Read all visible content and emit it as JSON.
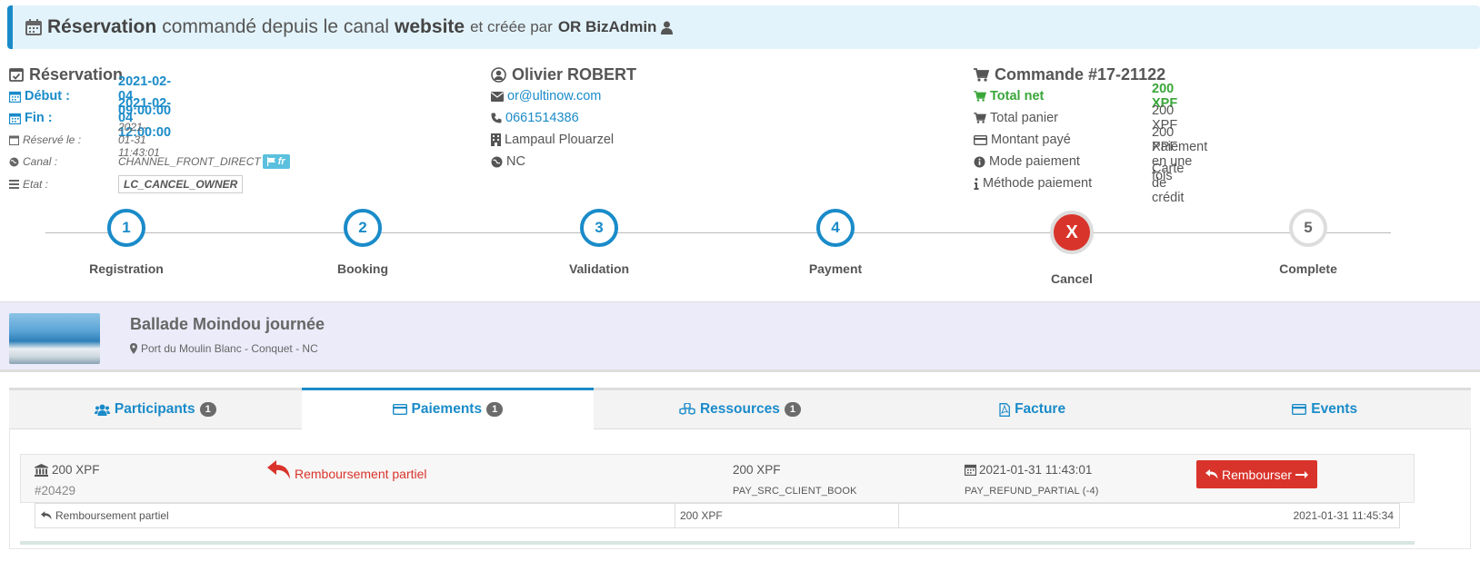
{
  "header": {
    "word1": "Réservation",
    "word2": "commandé depuis le canal",
    "channel": "website",
    "word3": "et créée par",
    "creator": "OR BizAdmin"
  },
  "reservation": {
    "title": "Réservation",
    "start_label": "Début :",
    "start_value": "2021-02-04 09:00:00",
    "end_label": "Fin :",
    "end_value": "2021-02-04 12:00:00",
    "booked_label": "Réservé le :",
    "booked_value": "2021-01-31 11:43:01",
    "channel_label": "Canal :",
    "channel_value": "CHANNEL_FRONT_DIRECT",
    "lang_badge": "fr",
    "state_label": "Etat :",
    "state_value": "LC_CANCEL_OWNER"
  },
  "customer": {
    "name": "Olivier ROBERT",
    "email": "or@ultinow.com",
    "phone": "0661514386",
    "city": "Lampaul Plouarzel",
    "country": "NC"
  },
  "order": {
    "title": "Commande #17-21122",
    "net_label": "Total net",
    "net_value": "200 XPF",
    "cart_label": "Total panier",
    "cart_value": "200 XPF",
    "paid_label": "Montant payé",
    "paid_value": "200 XPF",
    "mode_label": "Mode paiement",
    "mode_value": "Paiement en une fois",
    "method_label": "Méthode paiement",
    "method_value": "Carte de crédit"
  },
  "steps": [
    {
      "num": "1",
      "label": "Registration",
      "state": "done"
    },
    {
      "num": "2",
      "label": "Booking",
      "state": "done"
    },
    {
      "num": "3",
      "label": "Validation",
      "state": "done"
    },
    {
      "num": "4",
      "label": "Payment",
      "state": "done"
    },
    {
      "num": "X",
      "label": "Cancel",
      "state": "cancelled"
    },
    {
      "num": "5",
      "label": "Complete",
      "state": "pending"
    }
  ],
  "product": {
    "title": "Ballade Moindou journée",
    "location": "Port du Moulin Blanc - Conquet - NC"
  },
  "tabs": [
    {
      "label": "Participants",
      "count": "1",
      "icon": "users-icon"
    },
    {
      "label": "Paiements",
      "count": "1",
      "icon": "credit-card-icon"
    },
    {
      "label": "Ressources",
      "count": "1",
      "icon": "cubes-icon"
    },
    {
      "label": "Facture",
      "count": "",
      "icon": "file-pdf-icon"
    },
    {
      "label": "Events",
      "count": "",
      "icon": "list-icon"
    }
  ],
  "payment": {
    "amount": "200 XPF",
    "id": "#20429",
    "refund_type": "Remboursement partiel",
    "amount2": "200 XPF",
    "source": "PAY_SRC_CLIENT_BOOK",
    "date": "2021-01-31 11:43:01",
    "status": "PAY_REFUND_PARTIAL (-4)",
    "refund_button": "Rembourser",
    "sub": {
      "label": "Remboursement partiel",
      "amount": "200 XPF",
      "date": "2021-01-31 11:45:34"
    }
  },
  "colors": {
    "accent": "#1a8bc9",
    "danger": "#d9342b",
    "success": "#3aa63a",
    "banner_bg": "#e3f3fb",
    "product_bg": "#ebebfa"
  }
}
